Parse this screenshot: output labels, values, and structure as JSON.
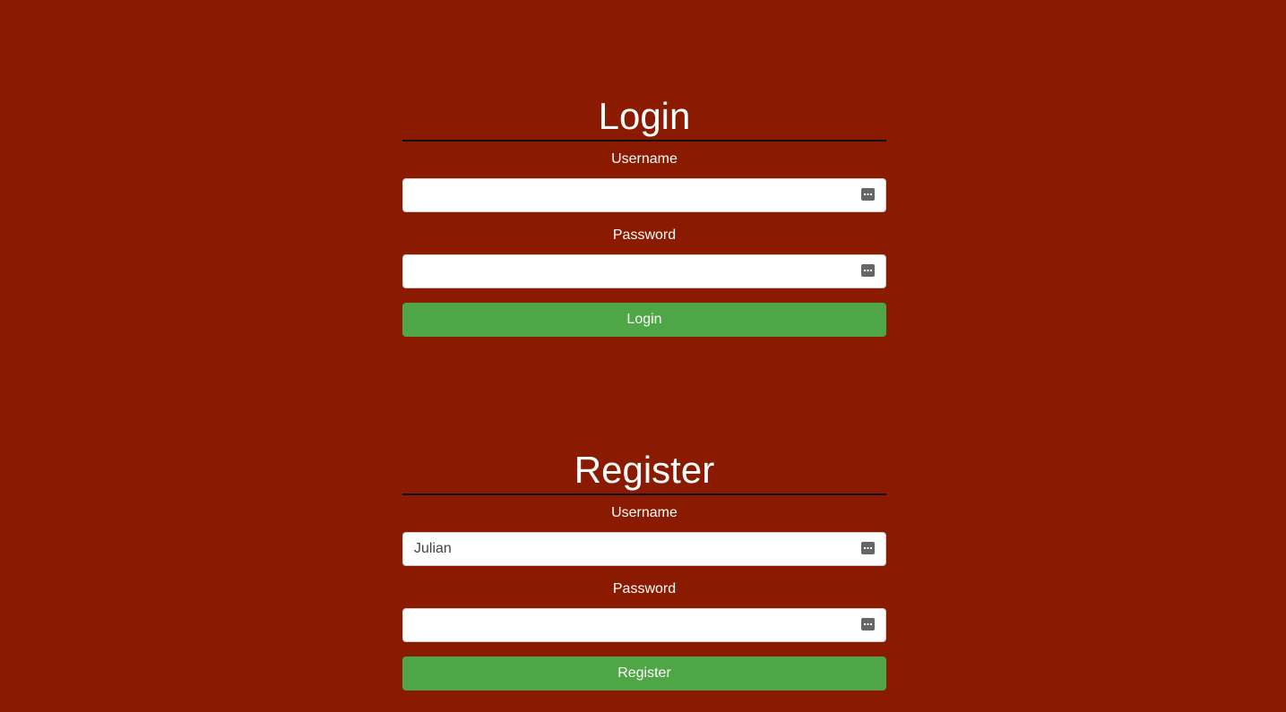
{
  "login": {
    "title": "Login",
    "username_label": "Username",
    "username_value": "",
    "password_label": "Password",
    "password_value": "",
    "button_label": "Login"
  },
  "register": {
    "title": "Register",
    "username_label": "Username",
    "username_value": "Julian",
    "password_label": "Password",
    "password_value": "",
    "button_label": "Register"
  },
  "colors": {
    "background": "#8b1b00",
    "button": "#4ea646",
    "rule": "#111111"
  },
  "icons": {
    "field_icon": "keyboard-icon"
  }
}
